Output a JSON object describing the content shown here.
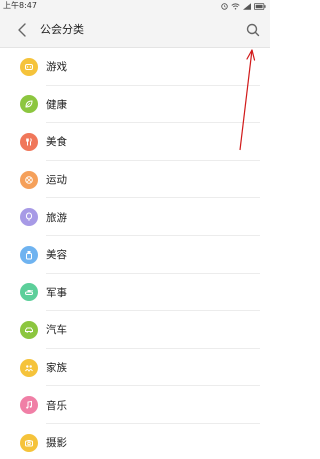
{
  "status_bar": {
    "time": "上午8:47"
  },
  "header": {
    "title": "公会分类"
  },
  "categories": [
    {
      "label": "游戏",
      "color": "#f5c33b",
      "icon": "gamepad-icon"
    },
    {
      "label": "健康",
      "color": "#8cc63f",
      "icon": "leaf-icon"
    },
    {
      "label": "美食",
      "color": "#f0775a",
      "icon": "utensils-icon"
    },
    {
      "label": "运动",
      "color": "#f5a05a",
      "icon": "ball-icon"
    },
    {
      "label": "旅游",
      "color": "#a79ae6",
      "icon": "balloon-icon"
    },
    {
      "label": "美容",
      "color": "#6fb3f0",
      "icon": "bottle-icon"
    },
    {
      "label": "军事",
      "color": "#5ccf9a",
      "icon": "tank-icon"
    },
    {
      "label": "汽车",
      "color": "#8cc63f",
      "icon": "car-icon"
    },
    {
      "label": "家族",
      "color": "#f5c33b",
      "icon": "family-icon"
    },
    {
      "label": "音乐",
      "color": "#f07fa6",
      "icon": "music-note-icon"
    },
    {
      "label": "摄影",
      "color": "#f5c33b",
      "icon": "camera-icon"
    }
  ],
  "annotation": {
    "color": "#d11a1a"
  }
}
